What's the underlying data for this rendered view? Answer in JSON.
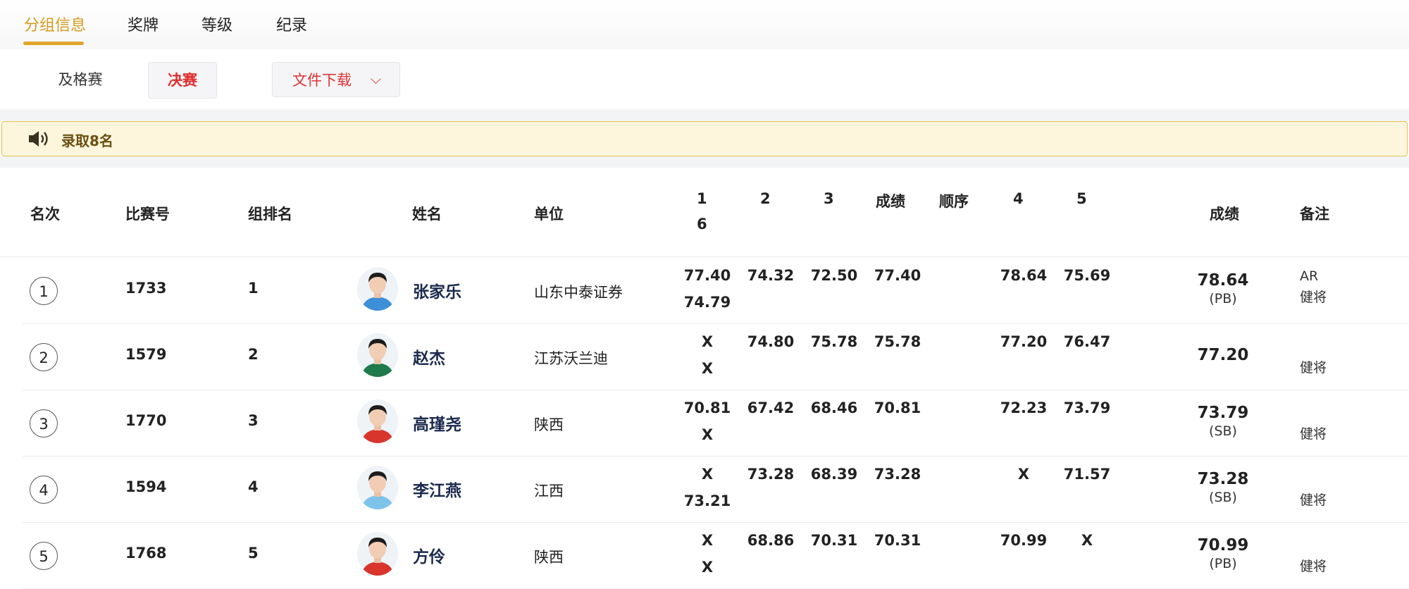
{
  "tabs": [
    {
      "label": "分组信息",
      "active": true
    },
    {
      "label": "奖牌",
      "active": false
    },
    {
      "label": "等级",
      "active": false
    },
    {
      "label": "纪录",
      "active": false
    }
  ],
  "filters": {
    "prelim": "及格赛",
    "final": "决赛",
    "download": "文件下载"
  },
  "notice": {
    "text": "录取8名"
  },
  "columns": {
    "rank": "名次",
    "bib": "比赛号",
    "group_rank": "组排名",
    "name": "姓名",
    "unit": "单位",
    "a1": "1",
    "a6": "6",
    "a2": "2",
    "a3": "3",
    "best3": "成绩",
    "order": "顺序",
    "a4": "4",
    "a5": "5",
    "result": "成绩",
    "remark": "备注"
  },
  "rows": [
    {
      "rank": "1",
      "bib": "1733",
      "group_rank": "1",
      "name": "张家乐",
      "unit": "山东中泰证券",
      "a1": "77.40",
      "a6": "74.79",
      "a2": "74.32",
      "a3": "72.50",
      "best3": "77.40",
      "a4": "78.64",
      "a5": "75.69",
      "result": "78.64",
      "mark": "(PB)",
      "record": "AR",
      "remark": "健将",
      "shirt": "#3d8fd8"
    },
    {
      "rank": "2",
      "bib": "1579",
      "group_rank": "2",
      "name": "赵杰",
      "unit": "江苏沃兰迪",
      "a1": "X",
      "a6": "X",
      "a2": "74.80",
      "a3": "75.78",
      "best3": "75.78",
      "a4": "77.20",
      "a5": "76.47",
      "result": "77.20",
      "mark": "",
      "record": "",
      "remark": "健将",
      "shirt": "#1f7a4c"
    },
    {
      "rank": "3",
      "bib": "1770",
      "group_rank": "3",
      "name": "高瑾尧",
      "unit": "陕西",
      "a1": "70.81",
      "a6": "X",
      "a2": "67.42",
      "a3": "68.46",
      "best3": "70.81",
      "a4": "72.23",
      "a5": "73.79",
      "result": "73.79",
      "mark": "(SB)",
      "record": "",
      "remark": "健将",
      "shirt": "#d8352d"
    },
    {
      "rank": "4",
      "bib": "1594",
      "group_rank": "4",
      "name": "李江燕",
      "unit": "江西",
      "a1": "X",
      "a6": "73.21",
      "a2": "73.28",
      "a3": "68.39",
      "best3": "73.28",
      "a4": "X",
      "a5": "71.57",
      "result": "73.28",
      "mark": "(SB)",
      "record": "",
      "remark": "健将",
      "shirt": "#7ec3ea"
    },
    {
      "rank": "5",
      "bib": "1768",
      "group_rank": "5",
      "name": "方伶",
      "unit": "陕西",
      "a1": "X",
      "a6": "X",
      "a2": "68.86",
      "a3": "70.31",
      "best3": "70.31",
      "a4": "70.99",
      "a5": "X",
      "result": "70.99",
      "mark": "(PB)",
      "record": "",
      "remark": "健将",
      "shirt": "#d8352d"
    }
  ],
  "colors": {
    "accent": "#e0a52a",
    "final_red": "#e02d2d",
    "notice_bg": "#fdf6dd",
    "notice_border": "#e3c04d"
  }
}
